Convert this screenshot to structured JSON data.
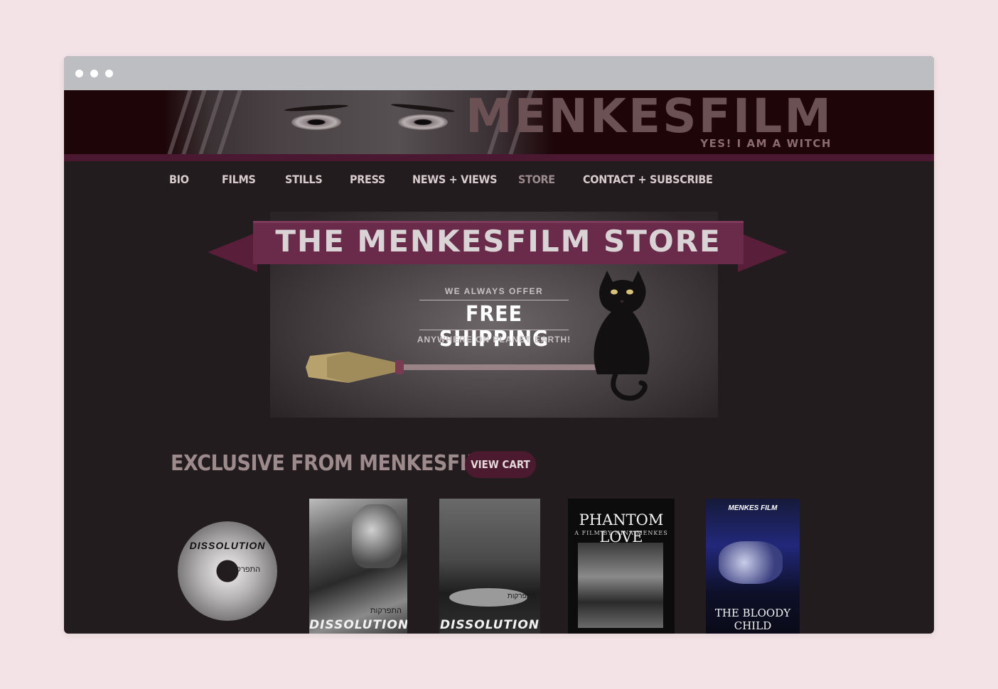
{
  "window": {
    "controls": [
      "close",
      "minimize",
      "maximize"
    ]
  },
  "header": {
    "brand": "MENKESFILM",
    "tagline": "YES! I AM A WITCH"
  },
  "nav": {
    "items": [
      {
        "label": "BIO"
      },
      {
        "label": "FILMS"
      },
      {
        "label": "STILLS"
      },
      {
        "label": "PRESS"
      },
      {
        "label": "NEWS + VIEWS"
      },
      {
        "label": "STORE"
      },
      {
        "label": "CONTACT + SUBSCRIBE"
      }
    ],
    "active": "STORE"
  },
  "banner": {
    "title": "THE MENKESFILM STORE",
    "line1": "WE ALWAYS OFFER",
    "line2": "FREE SHIPPING",
    "line3": "ANYWHERE ON PLANET EARTH!"
  },
  "store": {
    "section_title": "EXCLUSIVE FROM MENKESFILM",
    "cart_label": "VIEW CART",
    "products": [
      {
        "title": "DISSOLUTION",
        "hebrew": "התפרקות"
      },
      {
        "title": "DISSOLUTION",
        "hebrew": "התפרקות"
      },
      {
        "title": "DISSOLUTION",
        "hebrew": "התפרקות"
      },
      {
        "title": "PHANTOM LOVE",
        "subtitle": "A FILM BY NINA MENKES"
      },
      {
        "brand": "MENKES FILM",
        "title": "THE BLOODY CHILD"
      }
    ]
  },
  "colors": {
    "accent": "#6a2a4a",
    "background": "#231c1e",
    "page": "#f3e3e7"
  }
}
